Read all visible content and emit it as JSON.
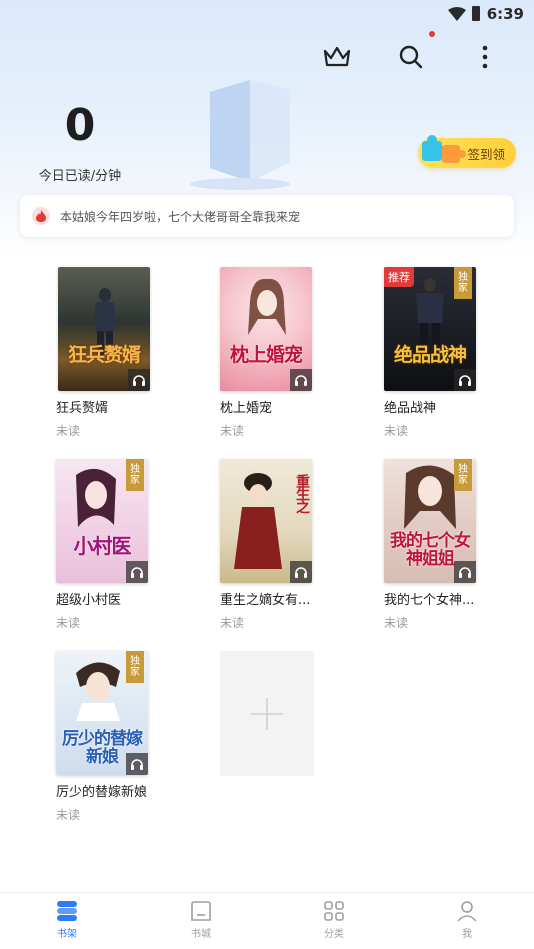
{
  "status_bar": {
    "time": "6:39"
  },
  "header": {
    "crown_icon": "crown-icon",
    "search_icon": "search-icon",
    "more_icon": "more-vertical-icon"
  },
  "reading": {
    "count": "0",
    "caption": "今日已读/分钟"
  },
  "checkin": {
    "label": "签到领"
  },
  "notice": {
    "text": "本姑娘今年四岁啦，七个大佬哥哥全靠我来宠"
  },
  "books": [
    {
      "title": "狂兵赘婿",
      "status": "未读",
      "cover_text": "狂兵赘婿",
      "tag": "",
      "audio": true
    },
    {
      "title": "枕上婚宠",
      "status": "未读",
      "cover_text": "枕上婚宠",
      "tag": "",
      "audio": true
    },
    {
      "title": "绝品战神",
      "status": "未读",
      "cover_text": "绝品战神",
      "tag": "推荐",
      "exclusive": "独家",
      "audio": true
    },
    {
      "title": "超级小村医",
      "status": "未读",
      "cover_text": "小村医",
      "exclusive": "独家",
      "audio": true
    },
    {
      "title": "重生之嫡女有...",
      "status": "未读",
      "cover_text": "重生之",
      "audio": true
    },
    {
      "title": "我的七个女神...",
      "status": "未读",
      "cover_text": "我的七个女神姐姐",
      "exclusive": "独家",
      "audio": true
    },
    {
      "title": "厉少的替嫁新娘",
      "status": "未读",
      "cover_text": "厉少的替嫁新娘",
      "exclusive": "独家",
      "audio": true
    }
  ],
  "tabs": [
    {
      "label": "书架",
      "icon": "bookshelf-icon",
      "active": true
    },
    {
      "label": "书城",
      "icon": "bookstore-icon",
      "active": false
    },
    {
      "label": "分类",
      "icon": "category-grid-icon",
      "active": false
    },
    {
      "label": "我",
      "icon": "profile-icon",
      "active": false
    }
  ],
  "colors": {
    "accent": "#2f7bf6",
    "checkin": "#ffd84a",
    "recommend": "#e23a3a",
    "exclusive": "#c79a3a"
  }
}
